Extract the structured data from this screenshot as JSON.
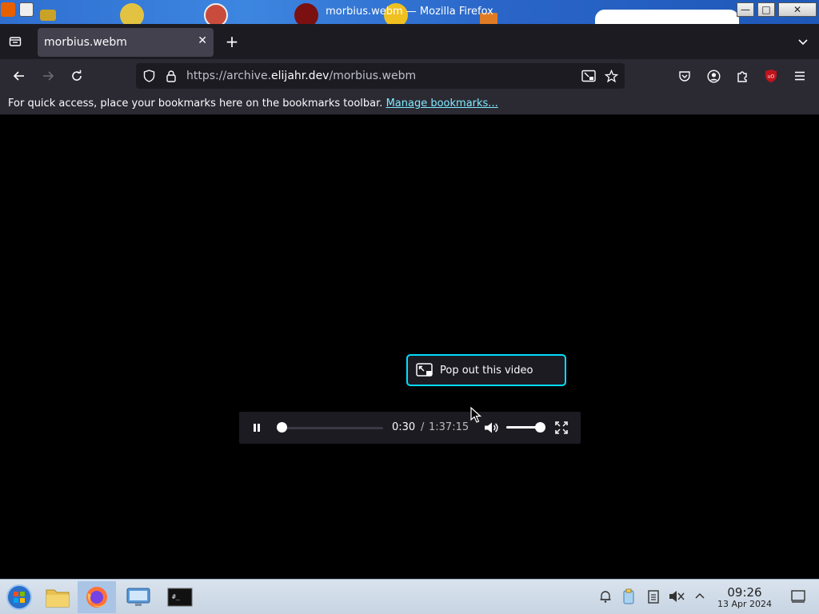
{
  "window": {
    "title": "morbius.webm — Mozilla Firefox",
    "controls": {
      "minimize": "—",
      "maximize": "□",
      "close": "✕"
    }
  },
  "tabs": [
    {
      "title": "morbius.webm",
      "close": "✕"
    }
  ],
  "toolbar": {
    "new_tab": "+",
    "tab_list_icon": "chevron-down-icon"
  },
  "nav": {
    "url_prefix": "https://archive.",
    "url_domain": "elijahr.dev",
    "url_path": "/morbius.webm"
  },
  "bookmarks": {
    "message": "For quick access, place your bookmarks here on the bookmarks toolbar.",
    "link": "Manage bookmarks..."
  },
  "video": {
    "popout_label": "Pop out this video",
    "current_time": "0:30",
    "separator": "/",
    "total_time": "1:37:15",
    "progress_fraction": 0.005,
    "volume_fraction": 1.0,
    "state": "playing"
  },
  "taskbar": {
    "time": "09:26",
    "date": "13 Apr 2024"
  },
  "colors": {
    "accent": "#00ddff",
    "link": "#80ebff",
    "ublock": "#c0141c"
  }
}
